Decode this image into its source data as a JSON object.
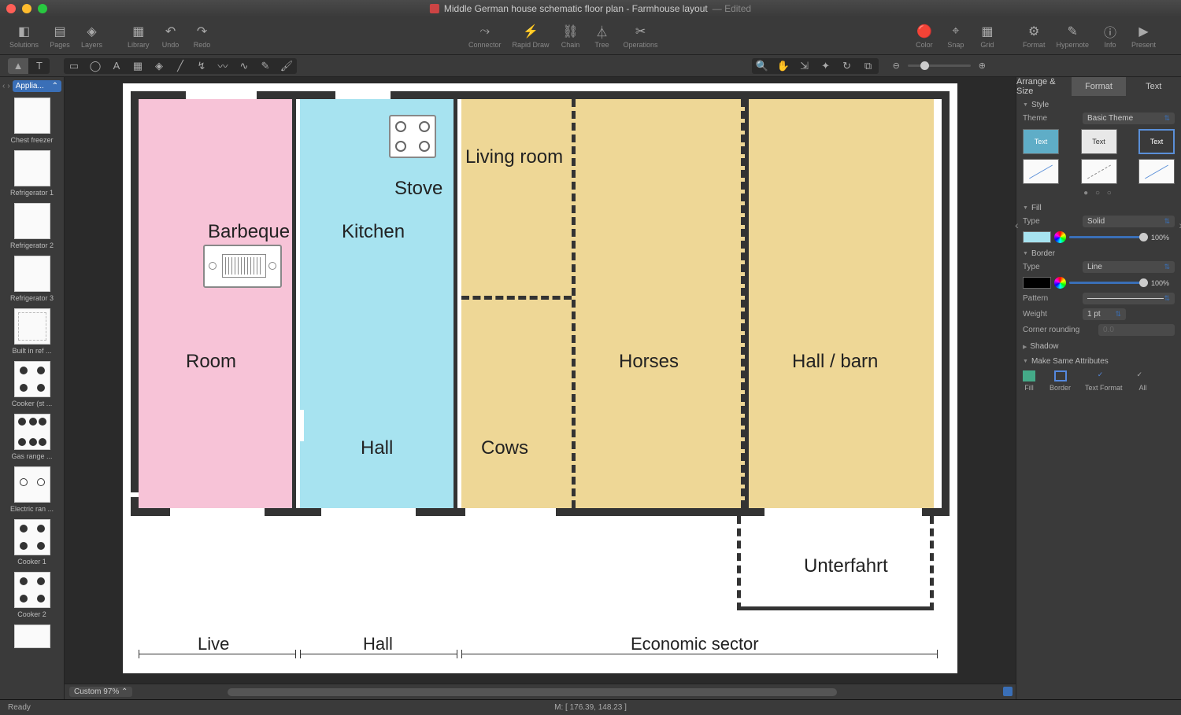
{
  "window": {
    "title": "Middle German house schematic floor plan - Farmhouse layout",
    "status": "Edited"
  },
  "toolbar_main": {
    "left": [
      {
        "label": "Solutions",
        "icon": "◧"
      },
      {
        "label": "Pages",
        "icon": "▤"
      },
      {
        "label": "Layers",
        "icon": "◈"
      }
    ],
    "left2": [
      {
        "label": "Library",
        "icon": "▦"
      },
      {
        "label": "Undo",
        "icon": "↶"
      },
      {
        "label": "Redo",
        "icon": "↷"
      }
    ],
    "center": [
      {
        "label": "Connector",
        "icon": "⤳"
      },
      {
        "label": "Rapid Draw",
        "icon": "⚡"
      },
      {
        "label": "Chain",
        "icon": "⛓"
      },
      {
        "label": "Tree",
        "icon": "⏃"
      },
      {
        "label": "Operations",
        "icon": "✂"
      }
    ],
    "right": [
      {
        "label": "Color",
        "icon": "🔴"
      },
      {
        "label": "Snap",
        "icon": "⌖"
      },
      {
        "label": "Grid",
        "icon": "▦"
      }
    ],
    "right2": [
      {
        "label": "Format",
        "icon": "⚙"
      },
      {
        "label": "Hypernote",
        "icon": "✎"
      },
      {
        "label": "Info",
        "icon": "ⓘ"
      },
      {
        "label": "Present",
        "icon": "▶"
      }
    ]
  },
  "library": {
    "name": "Applia...",
    "items": [
      "Chest freezer",
      "Refrigerator 1",
      "Refrigerator 2",
      "Refrigerator 3",
      "Built in ref ...",
      "Cooker (st ...",
      "Gas range ...",
      "Electric ran ...",
      "Cooker 1",
      "Cooker 2"
    ]
  },
  "canvas": {
    "zoom_label": "Custom 97%",
    "cursor": "M: [ 176.39, 148.23 ]",
    "status": "Ready",
    "rooms": {
      "room": "Room",
      "kitchen": "Kitchen",
      "hall": "Hall",
      "living": "Living room",
      "cows": "Cows",
      "horses": "Horses",
      "barn": "Hall / barn",
      "unterfahrt": "Unterfahrt",
      "barbeque": "Barbeque",
      "stove": "Stove"
    },
    "dims": {
      "live": "Live",
      "hall": "Hall",
      "econ": "Economic sector"
    }
  },
  "inspector": {
    "tabs": [
      "Arrange & Size",
      "Format",
      "Text"
    ],
    "active_tab": "Format",
    "style": {
      "header": "Style",
      "theme_label": "Theme",
      "theme_value": "Basic Theme",
      "swatch_text": "Text"
    },
    "fill": {
      "header": "Fill",
      "type_label": "Type",
      "type_value": "Solid",
      "opacity": "100%"
    },
    "border": {
      "header": "Border",
      "type_label": "Type",
      "type_value": "Line",
      "opacity": "100%",
      "pattern_label": "Pattern",
      "weight_label": "Weight",
      "weight_value": "1 pt",
      "corner_label": "Corner rounding",
      "corner_value": "0.0"
    },
    "shadow": {
      "header": "Shadow"
    },
    "make_same": {
      "header": "Make Same Attributes",
      "items": [
        "Fill",
        "Border",
        "Text Format",
        "All"
      ]
    }
  }
}
